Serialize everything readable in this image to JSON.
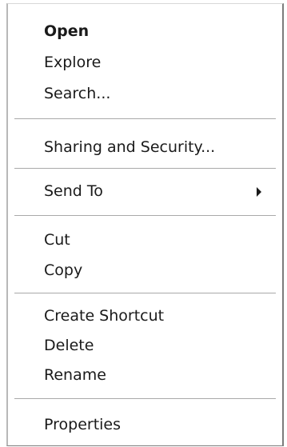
{
  "context_menu": {
    "items": [
      {
        "label": "Open"
      },
      {
        "label": "Explore"
      },
      {
        "label": "Search..."
      },
      {
        "label": "Sharing and Security..."
      },
      {
        "label": "Send To",
        "submenu_icon": "chevron-right-icon"
      },
      {
        "label": "Cut"
      },
      {
        "label": "Copy"
      },
      {
        "label": "Create Shortcut"
      },
      {
        "label": "Delete"
      },
      {
        "label": "Rename"
      },
      {
        "label": "Properties"
      }
    ]
  }
}
